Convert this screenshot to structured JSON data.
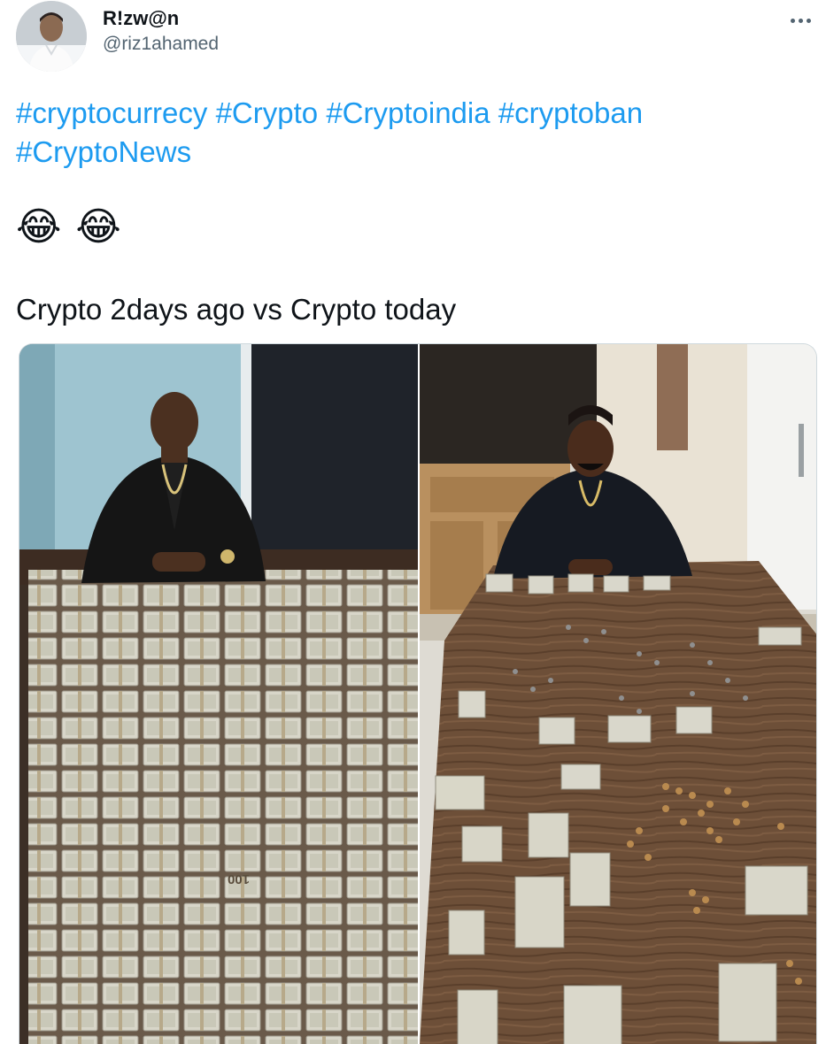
{
  "tweet": {
    "author": {
      "display_name": "R!zw@n",
      "handle": "@riz1ahamed"
    },
    "more_menu_icon": "more-horizontal-icon",
    "hashtags": [
      "#cryptocurrecy",
      "#Crypto",
      "#Cryptoindia",
      "#cryptoban",
      "#CryptoNews"
    ],
    "emojis": [
      "😂",
      "😂"
    ],
    "caption": "Crypto 2days ago vs Crypto today",
    "media": {
      "left_image": {
        "bill_label": "100"
      },
      "right_image": {}
    }
  },
  "colors": {
    "link": "#1d9bf0",
    "text": "#0f1419",
    "secondary_text": "#536471",
    "border": "#cfd9de"
  }
}
